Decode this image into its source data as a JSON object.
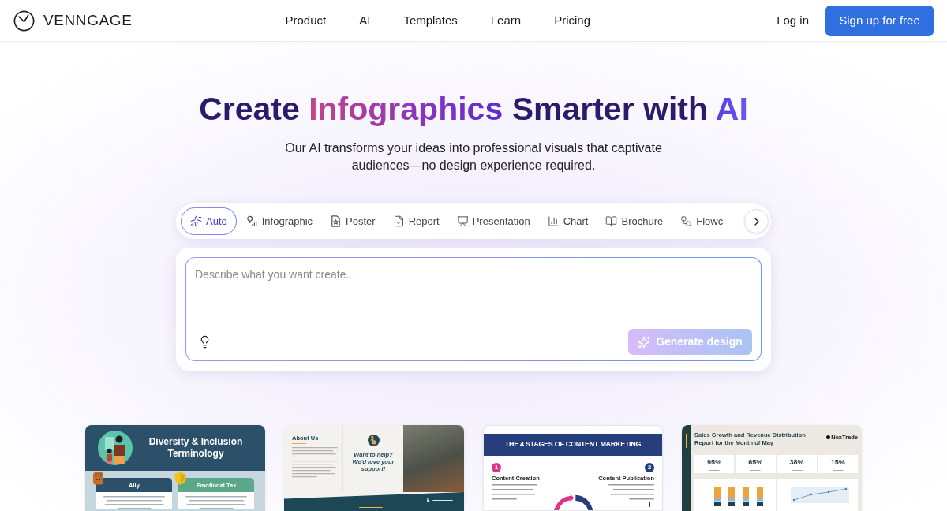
{
  "header": {
    "logo": "VENNGAGE",
    "nav": [
      {
        "label": "Product"
      },
      {
        "label": "AI"
      },
      {
        "label": "Templates"
      },
      {
        "label": "Learn"
      },
      {
        "label": "Pricing"
      }
    ],
    "login": "Log in",
    "signup": "Sign up for free"
  },
  "hero": {
    "title": [
      {
        "text": "Create",
        "kind": "plain"
      },
      {
        "text": "Infographics",
        "kind": "gradient"
      },
      {
        "text": "Smarter with",
        "kind": "plain"
      },
      {
        "text": "AI",
        "kind": "accent"
      }
    ],
    "subtitle": "Our AI transforms your ideas into professional visuals that captivate audiences—no design experience required."
  },
  "creator": {
    "types": [
      {
        "label": "Auto",
        "selected": true
      },
      {
        "label": "Infographic",
        "selected": false
      },
      {
        "label": "Poster",
        "selected": false
      },
      {
        "label": "Report",
        "selected": false
      },
      {
        "label": "Presentation",
        "selected": false
      },
      {
        "label": "Chart",
        "selected": false
      },
      {
        "label": "Brochure",
        "selected": false
      },
      {
        "label": "Flowc",
        "selected": false
      }
    ],
    "prompt": {
      "placeholder": "Describe what you want create..."
    },
    "generate": {
      "label": "Generate design",
      "disabled": true
    }
  },
  "templates": [
    {
      "kind": "terms",
      "title": "Diversity & Inclusion Terminology",
      "terms": [
        {
          "name": "Ally",
          "color": "#2c5069"
        },
        {
          "name": "Emotional Tax",
          "color": "#5ba888"
        }
      ]
    },
    {
      "kind": "brochure",
      "heading": "About Us",
      "callout": "Want to help? We'd love your support!"
    },
    {
      "kind": "stages",
      "title": "THE 4 STAGES OF CONTENT MARKETING",
      "stages": [
        {
          "number": "1",
          "name": "Content Creation",
          "color": "#e0338a"
        },
        {
          "number": "2",
          "name": "Content Publication",
          "color": "#263f7c"
        }
      ]
    },
    {
      "kind": "report",
      "title": "Sales Growth and Revenue Distribution Report for the Month of May",
      "brand": "NexTrade",
      "stats": [
        {
          "value": "95%"
        },
        {
          "value": "65%"
        },
        {
          "value": "38%"
        },
        {
          "value": "15%"
        }
      ],
      "panels": [
        {
          "kind": "bars"
        },
        {
          "kind": "lines"
        }
      ]
    }
  ]
}
